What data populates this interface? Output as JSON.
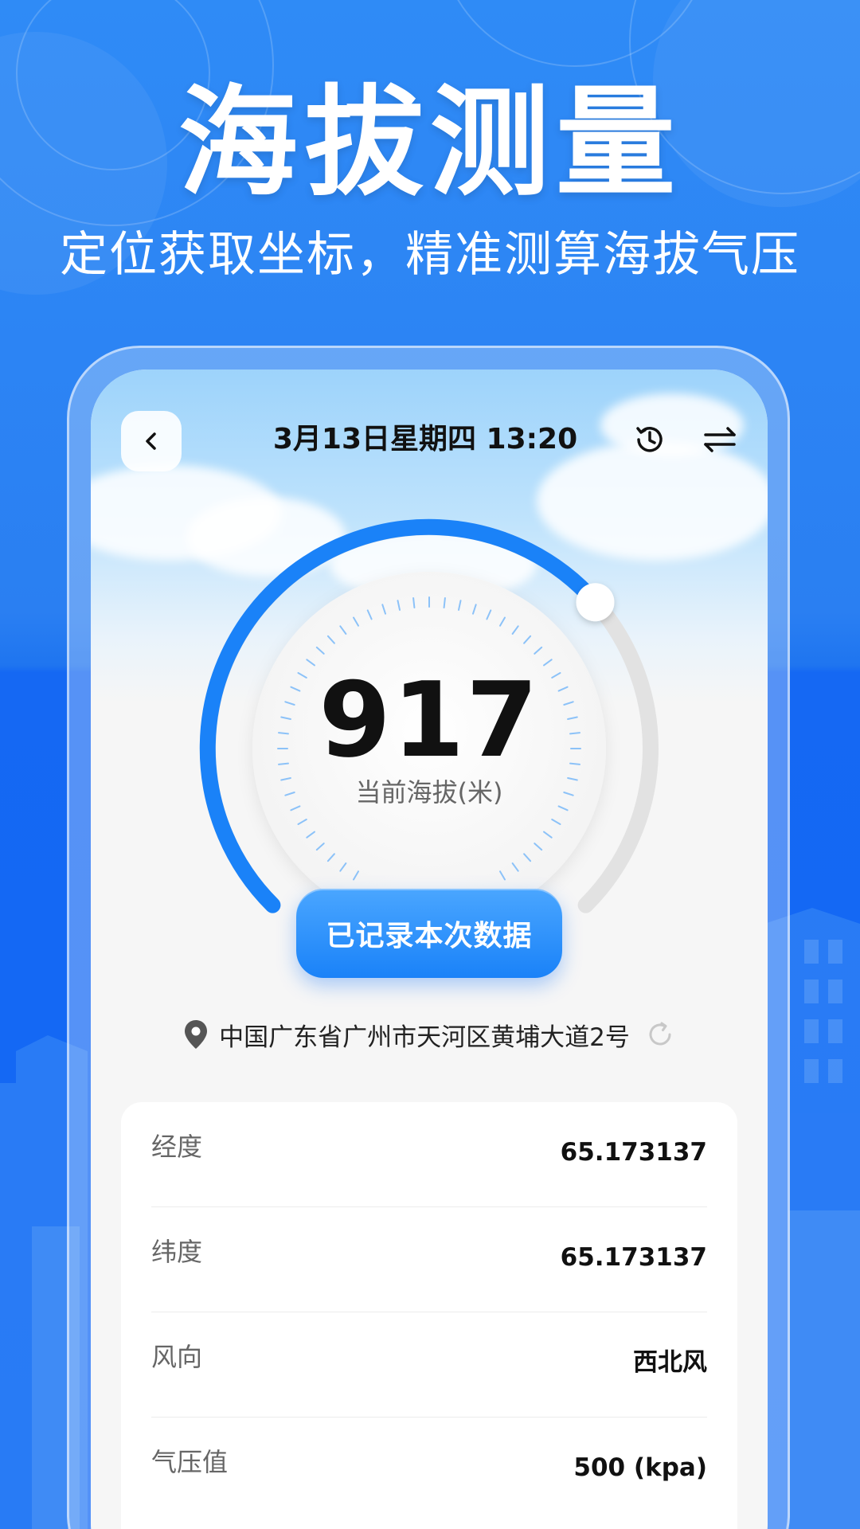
{
  "hero": {
    "title": "海拔测量",
    "subtitle": "定位获取坐标，精准测算海拔气压"
  },
  "colors": {
    "background_blue": "#1268f5",
    "accent_blue": "#1a82f8",
    "gauge_track": "#e2e2e2"
  },
  "app": {
    "header": {
      "back_icon": "chevron-left-icon",
      "datetime": "3月13日星期四 13:20",
      "history_icon": "history-clock-icon",
      "switch_icon": "swap-arrows-icon"
    },
    "altitude": {
      "value": "917",
      "label": "当前海拔(米)",
      "gauge_fill_fraction": 0.68
    },
    "record_button_label": "已记录本次数据",
    "location": {
      "pin_icon": "location-pin-icon",
      "address": "中国广东省广州市天河区黄埔大道2号",
      "refresh_icon": "refresh-icon"
    },
    "info": [
      {
        "label": "经度",
        "value": "65.173137"
      },
      {
        "label": "纬度",
        "value": "65.173137"
      },
      {
        "label": "风向",
        "value": "西北风"
      },
      {
        "label": "气压值",
        "value": "500 (kpa)"
      }
    ]
  }
}
